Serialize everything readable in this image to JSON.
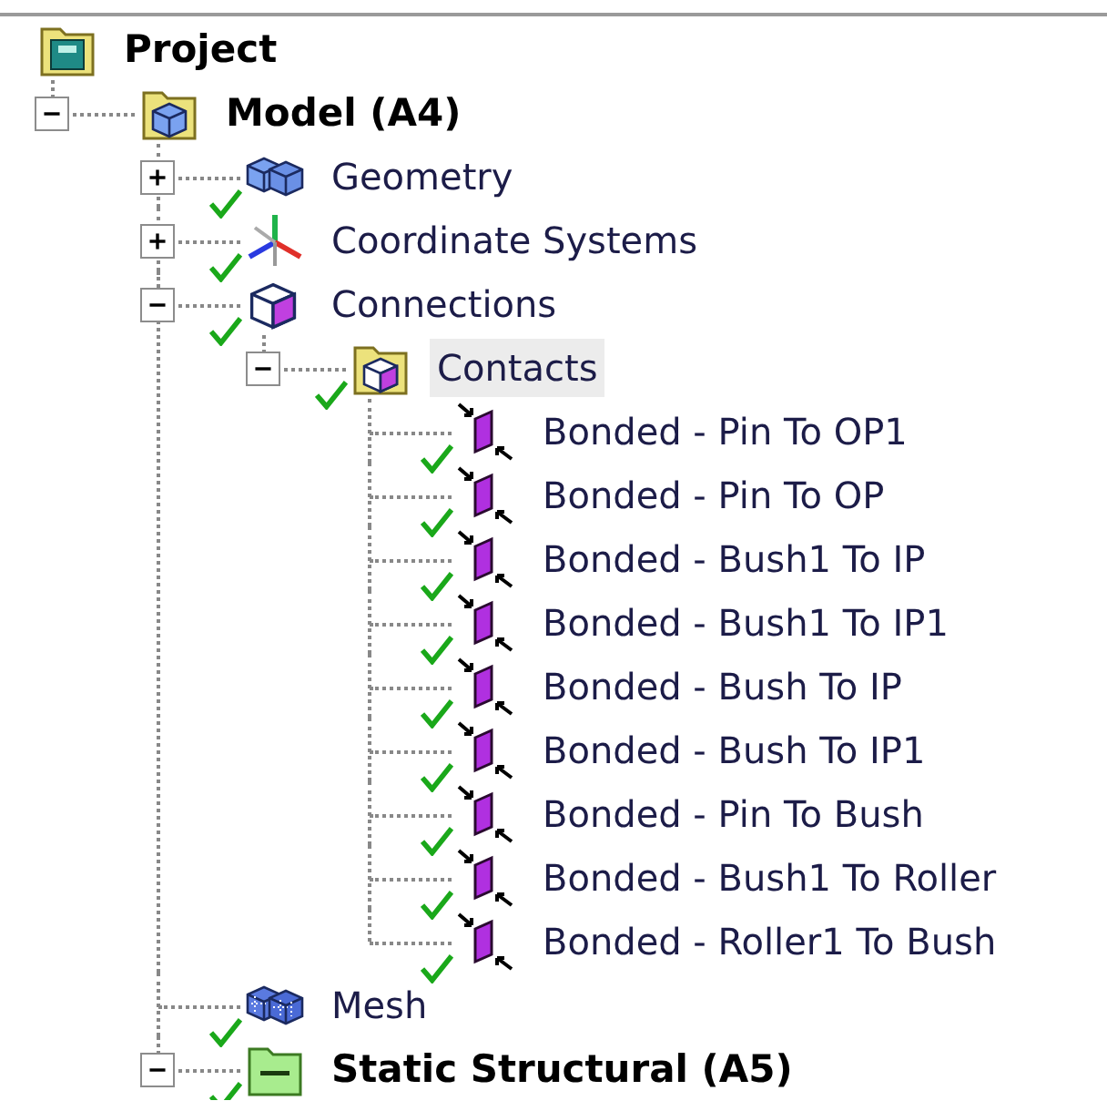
{
  "tree": [
    {
      "label": "Project",
      "kind": "project",
      "bold": true,
      "checked": false,
      "selected": false,
      "children": [
        {
          "label": "Model (A4)",
          "kind": "model",
          "bold": true,
          "checked": false,
          "selected": false,
          "expanded": true,
          "children": [
            {
              "label": "Geometry",
              "kind": "geometry",
              "bold": false,
              "checked": true,
              "selected": false,
              "expanded": false
            },
            {
              "label": "Coordinate Systems",
              "kind": "coordinate_systems",
              "bold": false,
              "checked": true,
              "selected": false,
              "expanded": false
            },
            {
              "label": "Connections",
              "kind": "connections",
              "bold": false,
              "checked": true,
              "selected": false,
              "expanded": true,
              "children": [
                {
                  "label": "Contacts",
                  "kind": "contacts",
                  "bold": false,
                  "checked": true,
                  "selected": true,
                  "expanded": true,
                  "children": [
                    {
                      "label": "Bonded - Pin To OP1",
                      "kind": "contact",
                      "bold": false,
                      "checked": true,
                      "selected": false
                    },
                    {
                      "label": "Bonded - Pin To OP",
                      "kind": "contact",
                      "bold": false,
                      "checked": true,
                      "selected": false
                    },
                    {
                      "label": "Bonded - Bush1 To IP",
                      "kind": "contact",
                      "bold": false,
                      "checked": true,
                      "selected": false
                    },
                    {
                      "label": "Bonded - Bush1 To IP1",
                      "kind": "contact",
                      "bold": false,
                      "checked": true,
                      "selected": false
                    },
                    {
                      "label": "Bonded - Bush To IP",
                      "kind": "contact",
                      "bold": false,
                      "checked": true,
                      "selected": false
                    },
                    {
                      "label": "Bonded - Bush To IP1",
                      "kind": "contact",
                      "bold": false,
                      "checked": true,
                      "selected": false
                    },
                    {
                      "label": "Bonded - Pin To Bush",
                      "kind": "contact",
                      "bold": false,
                      "checked": true,
                      "selected": false
                    },
                    {
                      "label": "Bonded - Bush1 To Roller",
                      "kind": "contact",
                      "bold": false,
                      "checked": true,
                      "selected": false
                    },
                    {
                      "label": "Bonded - Roller1 To Bush",
                      "kind": "contact",
                      "bold": false,
                      "checked": true,
                      "selected": false
                    }
                  ]
                }
              ]
            },
            {
              "label": "Mesh",
              "kind": "mesh",
              "bold": false,
              "checked": true,
              "selected": false
            },
            {
              "label": "Static Structural (A5)",
              "kind": "analysis",
              "bold": true,
              "checked": true,
              "selected": false,
              "expanded": true
            }
          ]
        }
      ]
    }
  ]
}
